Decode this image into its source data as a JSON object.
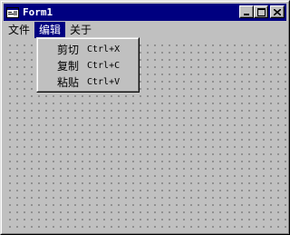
{
  "window": {
    "title": "Form1",
    "controls": [
      "minimize",
      "maximize",
      "close"
    ],
    "title_color": "#000080",
    "face_color": "#c0c0c0"
  },
  "menubar": {
    "items": [
      {
        "label": "文件"
      },
      {
        "label": "编辑",
        "active": true
      },
      {
        "label": "关于"
      }
    ]
  },
  "dropdown": {
    "items": [
      {
        "label": "剪切",
        "shortcut": "Ctrl+X"
      },
      {
        "label": "复制",
        "shortcut": "Ctrl+C"
      },
      {
        "label": "粘贴",
        "shortcut": "Ctrl+V"
      }
    ]
  }
}
